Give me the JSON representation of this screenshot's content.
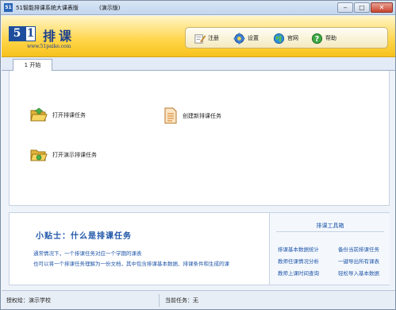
{
  "window": {
    "title": "51智能排课系统大课表版",
    "subtitle": "(演示版)",
    "app_icon_text": "51",
    "controls": {
      "minimize": "‒",
      "maximize": "□",
      "close": "✕"
    }
  },
  "banner": {
    "logo_five": "5",
    "logo_one": "1",
    "logo_name": "排课",
    "logo_url": "www.51paike.com",
    "brand_color": "#1b3f8e",
    "toolbar": [
      {
        "label": "注册",
        "icon": "register-pencil-icon"
      },
      {
        "label": "设置",
        "icon": "gear-icon"
      },
      {
        "label": "官网",
        "icon": "globe-icon"
      },
      {
        "label": "帮助",
        "icon": "help-question-icon"
      }
    ]
  },
  "tabs": [
    {
      "label": "1 开始"
    }
  ],
  "tasks": {
    "open": {
      "label": "打开排课任务",
      "icon": "open-folder-icon"
    },
    "create": {
      "label": "创建新排课任务",
      "icon": "new-document-icon"
    },
    "open_demo": {
      "label": "打开演示排课任务",
      "icon": "demo-folder-icon"
    }
  },
  "tips": {
    "title": "小贴士：什么是排课任务",
    "line1": "通常情况下，一个排课任务对应一个学期的课表",
    "line2": "也可以将一个排课任务理解为一份文档，其中包含排课基本数据、排课条件和生成的课"
  },
  "toolbox": {
    "title": "排课工具箱",
    "links": [
      "排课基本数据统计",
      "备份当前排课任务",
      "教师任课情况分析",
      "一键导出所有课表",
      "教师上课时间查询",
      "轻松导入基本数据"
    ]
  },
  "status": {
    "licensee_label": "授权给：演示学校",
    "current_task_label": "当前任务：无"
  },
  "colors": {
    "banner_yellow": "#ffd54a",
    "link_blue": "#1f55a8",
    "close_red": "#c9452f"
  }
}
